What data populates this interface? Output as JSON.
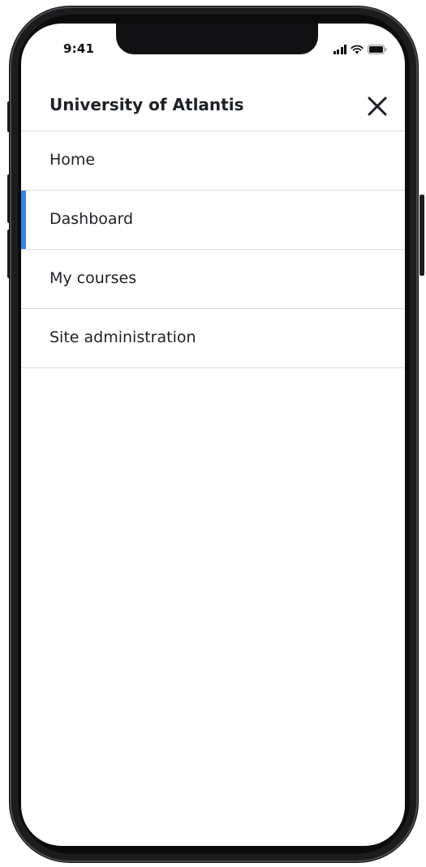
{
  "status_bar": {
    "time": "9:41"
  },
  "header": {
    "title": "University of Atlantis",
    "close_icon": "close-icon"
  },
  "menu": {
    "items": [
      {
        "label": "Home",
        "active": false
      },
      {
        "label": "Dashboard",
        "active": true
      },
      {
        "label": "My courses",
        "active": false
      },
      {
        "label": "Site administration",
        "active": false
      }
    ]
  },
  "icons": {
    "signal": "signal-icon",
    "wifi": "wifi-icon",
    "battery": "battery-icon"
  },
  "colors": {
    "active_indicator": "#3584e4",
    "text": "#1d2125",
    "divider": "#dcdcdc"
  }
}
